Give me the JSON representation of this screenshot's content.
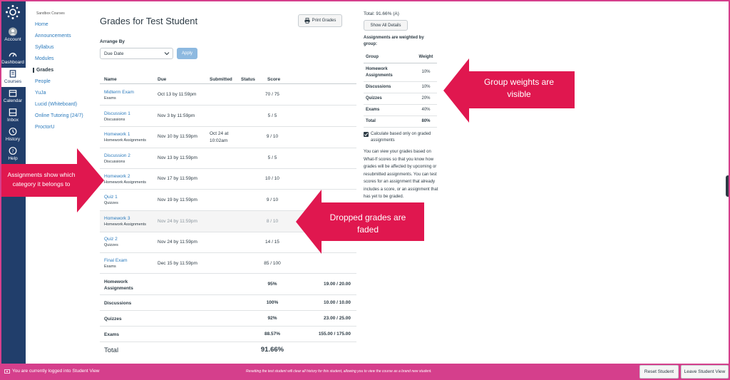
{
  "global_nav": {
    "items": [
      {
        "label": "Account",
        "icon": "account-icon"
      },
      {
        "label": "Dashboard",
        "icon": "dashboard-icon"
      },
      {
        "label": "Courses",
        "icon": "courses-icon",
        "active": true
      },
      {
        "label": "Calendar",
        "icon": "calendar-icon"
      },
      {
        "label": "Inbox",
        "icon": "inbox-icon"
      },
      {
        "label": "History",
        "icon": "history-icon"
      },
      {
        "label": "Help",
        "icon": "help-icon"
      }
    ]
  },
  "course_nav": {
    "breadcrumb": "Sandbox Courses",
    "items": [
      "Home",
      "Announcements",
      "Syllabus",
      "Modules",
      "Grades",
      "People",
      "YuJa",
      "Lucid (Whiteboard)",
      "Online Tutoring (24/7)",
      "ProctorU"
    ],
    "active": "Grades"
  },
  "main": {
    "title": "Grades for Test Student",
    "print_label": "Print Grades",
    "arrange_label": "Arrange By",
    "arrange_value": "Due Date",
    "apply_label": "Apply",
    "columns": [
      "Name",
      "Due",
      "Submitted",
      "Status",
      "Score"
    ],
    "assignments": [
      {
        "name": "Midterm Exam",
        "category": "Exams",
        "due": "Oct 13 by 11:59pm",
        "submitted": "",
        "score": "70 / 75",
        "faded": false
      },
      {
        "name": "Discussion 1",
        "category": "Discussions",
        "due": "Nov 3 by 11:59pm",
        "submitted": "",
        "score": "5 / 5",
        "faded": false
      },
      {
        "name": "Homework 1",
        "category": "Homework Assignments",
        "due": "Nov 10 by 11:59pm",
        "submitted": "Oct 24 at 10:02am",
        "score": "9 / 10",
        "faded": false
      },
      {
        "name": "Discussion 2",
        "category": "Discussions",
        "due": "Nov 13 by 11:59pm",
        "submitted": "",
        "score": "5 / 5",
        "faded": false
      },
      {
        "name": "Homework 2",
        "category": "Homework Assignments",
        "due": "Nov 17 by 11:59pm",
        "submitted": "",
        "score": "10 / 10",
        "faded": false
      },
      {
        "name": "Quiz 1",
        "category": "Quizzes",
        "due": "Nov 19 by 11:59pm",
        "submitted": "",
        "score": "9 / 10",
        "faded": false
      },
      {
        "name": "Homework 3",
        "category": "Homework Assignments",
        "due": "Nov 24 by 11:59pm",
        "submitted": "",
        "score": "8 / 10",
        "faded": true
      },
      {
        "name": "Quiz 2",
        "category": "Quizzes",
        "due": "Nov 24 by 11:59pm",
        "submitted": "",
        "score": "14 / 15",
        "faded": false
      },
      {
        "name": "Final Exam",
        "category": "Exams",
        "due": "Dec 15 by 11:59pm",
        "submitted": "",
        "score": "85 / 100",
        "faded": false
      }
    ],
    "groups": [
      {
        "name": "Homework Assignments",
        "percent": "95%",
        "fraction": "19.00 / 20.00"
      },
      {
        "name": "Discussions",
        "percent": "100%",
        "fraction": "10.00 / 10.00"
      },
      {
        "name": "Quizzes",
        "percent": "92%",
        "fraction": "23.00 / 25.00"
      },
      {
        "name": "Exams",
        "percent": "88.57%",
        "fraction": "155.00 / 175.00"
      }
    ],
    "total_label": "Total",
    "total_value": "91.66%"
  },
  "sidebar": {
    "total": "Total: 91.66% (A)",
    "show_all_label": "Show All Details",
    "weighted_label": "Assignments are weighted by group:",
    "weight_headers": [
      "Group",
      "Weight"
    ],
    "weights": [
      {
        "group": "Homework Assignments",
        "weight": "10%"
      },
      {
        "group": "Discussions",
        "weight": "10%"
      },
      {
        "group": "Quizzes",
        "weight": "20%"
      },
      {
        "group": "Exams",
        "weight": "40%"
      },
      {
        "group": "Total",
        "weight": "80%"
      }
    ],
    "calc_label": "Calculate based only on graded assignments",
    "calc_checked": true,
    "explanation": "You can view your grades based on What-If scores so that you know how grades will be affected by upcoming or resubmitted assignments. You can test scores for an assignment that already includes a score, or an assignment that has yet to be graded."
  },
  "annotations": {
    "weights": [
      "Group weights are",
      "visible"
    ],
    "category": [
      "Assignments show which",
      "category  it belongs to"
    ],
    "dropped": [
      "Dropped grades are",
      "faded"
    ],
    "color": "#e0174f"
  },
  "bottom_bar": {
    "student_view": "You are currently logged into Student View",
    "reset_msg": "Resetting the test student will clear all history for this student, allowing you to view the course as a brand new student.",
    "reset_label": "Reset Student",
    "leave_label": "Leave Student View",
    "color": "#d53f8c"
  }
}
